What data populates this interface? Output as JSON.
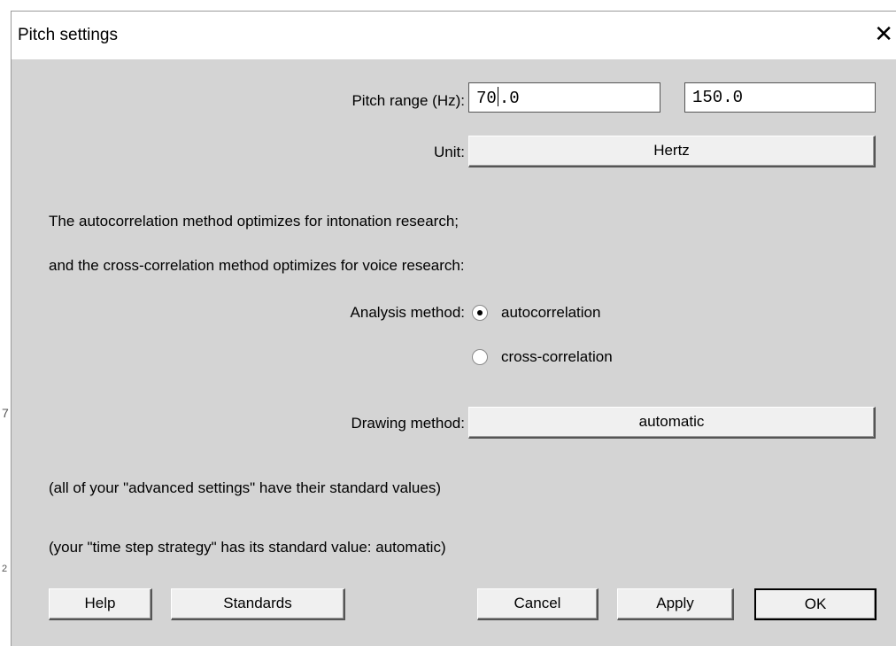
{
  "background": {
    "glyph_1": "7",
    "glyph_2": "2"
  },
  "dialog": {
    "title": "Pitch settings",
    "close_glyph": "✕"
  },
  "pitch_range": {
    "label": "Pitch range (Hz):",
    "min_value_before_caret": "70",
    "min_value_after_caret": ".0",
    "max_value": "150.0"
  },
  "unit": {
    "label": "Unit:",
    "value": "Hertz"
  },
  "info": {
    "line1": "The autocorrelation method optimizes for intonation research;",
    "line2": "and the cross-correlation method optimizes for voice research:"
  },
  "analysis_method": {
    "label": "Analysis method:",
    "options": [
      {
        "label": "autocorrelation",
        "selected": true
      },
      {
        "label": "cross-correlation",
        "selected": false
      }
    ]
  },
  "drawing_method": {
    "label": "Drawing method:",
    "value": "automatic"
  },
  "notes": {
    "advanced": "(all of your \"advanced settings\" have their standard values)",
    "time_step": "(your \"time step strategy\" has its standard value: automatic)"
  },
  "buttons": {
    "help": "Help",
    "standards": "Standards",
    "cancel": "Cancel",
    "apply": "Apply",
    "ok": "OK"
  }
}
